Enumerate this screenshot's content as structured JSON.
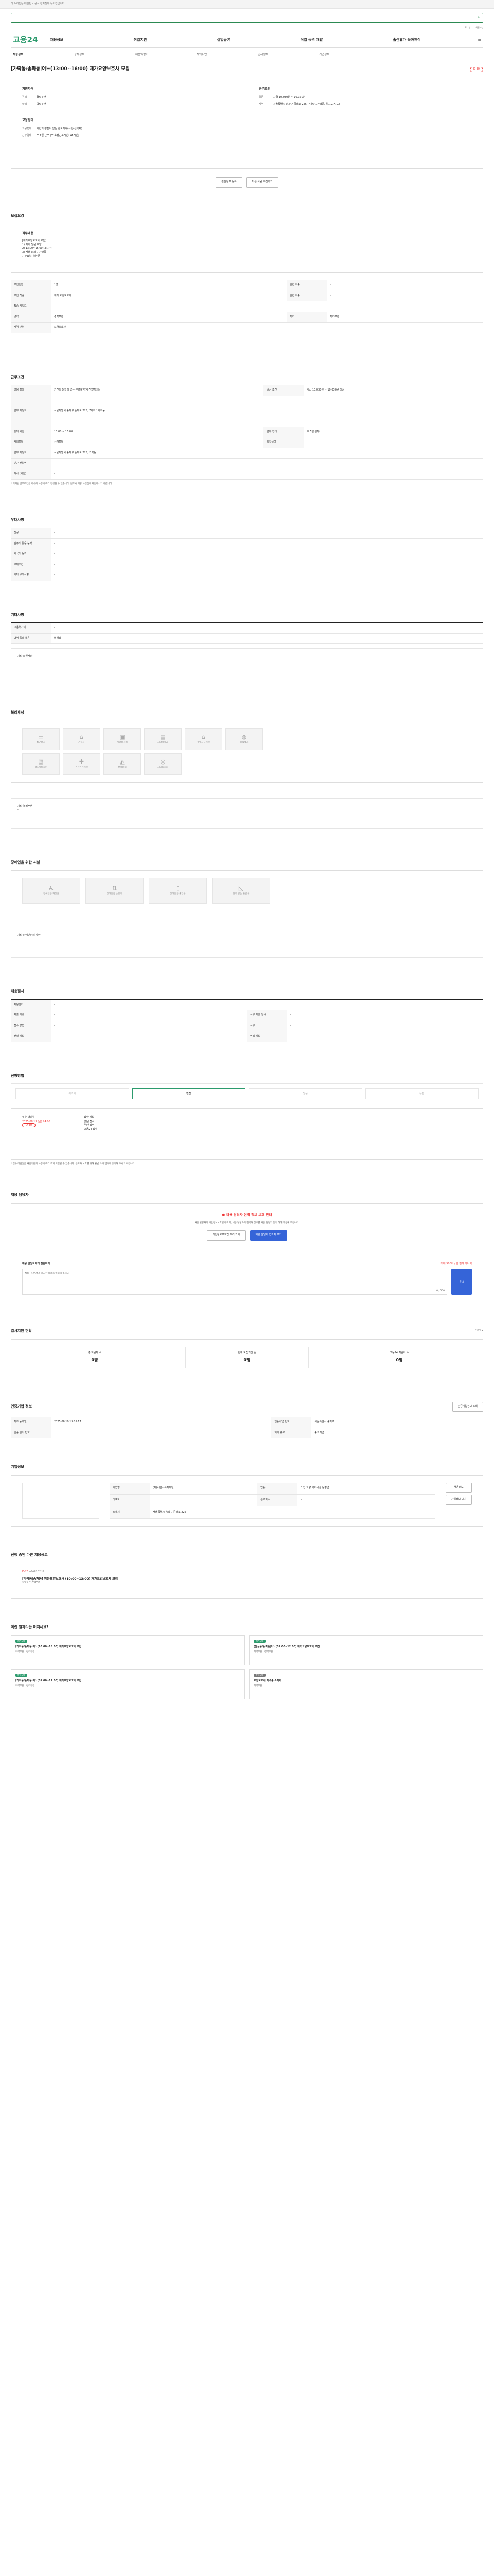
{
  "top": {
    "notice": "이 누리집은 대한민국 공식 전자정부 누리집입니다.",
    "search_placeholder": "",
    "util": [
      "로그인",
      "회원가입"
    ]
  },
  "gnb": {
    "logo": "고용24",
    "menu": [
      "채용정보",
      "취업지원",
      "실업급여",
      "직업 능력 개발",
      "출산휴가 육아휴직"
    ],
    "all": "≡"
  },
  "tabs": [
    "채용정보",
    "공채정보",
    "채용박람회",
    "해외취업",
    "인재정보",
    "기업정보"
  ],
  "title": "[가락동/송파동|어느(13:00~16:00) 재가요양보호사 모집",
  "dday": "D-30",
  "summary": {
    "left": {
      "head": "지원자격",
      "rows": [
        [
          "경력",
          "경력무관"
        ],
        [
          "학력",
          "학력무관"
        ]
      ],
      "head2": "고용형태",
      "rows2": [
        [
          "고용형태",
          "기간의 정함이 없는 근로계약(시간(선택제)"
        ],
        [
          "근무형태",
          "주 5일 근무 (주 소정근로시간: 15시간)"
        ]
      ]
    },
    "right": {
      "head": "근무조건",
      "rows": [
        [
          "임금",
          "시급 10,030원 ~ 10,030원"
        ],
        [
          "지역",
          "서울특별시 송파구 중대로 225, 7가락 1가락동, 위치도(지도)"
        ]
      ]
    },
    "buttons": [
      "관심정보 등록",
      "다른 사람 추천하기"
    ]
  },
  "recruit": {
    "heading": "모집요강",
    "duty_label": "직무내용",
    "duty": "[재가요양보호사 모집]\n1) 재가 방문 요양\n2) 13:00~16:00 (3시간)\n3) 서울 송파구 가락동\n근무요일: 월~금",
    "rows": [
      [
        "모집인원",
        "1명",
        "관련 직종",
        "-"
      ],
      [
        "모집 직종",
        "재가 요양보호사",
        "관련 직종",
        "-"
      ],
      [
        "직종 키워드",
        "-",
        "",
        ""
      ],
      [
        "경력",
        "경력무관",
        "학력",
        "학력무관"
      ],
      [
        "자격 면허",
        "요양보호사",
        "",
        ""
      ]
    ]
  },
  "work": {
    "heading": "근무조건",
    "rows": [
      [
        "고용 형태",
        "기간의 정함이 없는 근로계약(시간(선택제)",
        "임금 조건",
        "시급 10,030원 ~ 10,030원 이상"
      ],
      [
        "근무 예정지",
        "서울특별시 송파구 중대로 225, 7가락 1가락동",
        "",
        ""
      ],
      [
        "출퇴 시간",
        "13:00 ~ 16:00",
        "근무 형태",
        "주 5일 근무"
      ],
      [
        "사회보험",
        "산재보험",
        "퇴직급여",
        "-"
      ],
      [
        "근무 예정지",
        "서울특별시 송파구 중대로 225, 가락동",
        "",
        ""
      ],
      [
        "인근 전철역",
        "-",
        "",
        ""
      ],
      [
        "식사 (시간)",
        "-",
        "",
        ""
      ]
    ],
    "note": "* 기재된 근무조건은 회사의 사정에 따라 변경될 수 있습니다. 반드시 해당 사업장에 확인하시기 바랍니다."
  },
  "pref": {
    "heading": "우대사항",
    "rows": [
      [
        "전공",
        "-"
      ],
      [
        "컴퓨터 활용 능력",
        "-"
      ],
      [
        "외국어 능력",
        "-"
      ],
      [
        "우대조건",
        "-"
      ],
      [
        "기타 우대사항",
        "-"
      ]
    ]
  },
  "etc": {
    "heading": "기타사항",
    "rows": [
      [
        "고용허가제",
        "-"
      ],
      [
        "병역 특례 채용",
        "비해당"
      ]
    ],
    "extra_label": "기타 회원사항"
  },
  "welfare": {
    "heading": "복리후생",
    "items": [
      "통근버스",
      "기숙사",
      "차량유지비",
      "자녀학자금",
      "주택자금지원",
      "중식제공",
      "경조사비지원",
      "건강검진지원",
      "산학협력",
      "사내동호회"
    ],
    "extra_label": "기타 복리후생",
    "extra": "-"
  },
  "support": {
    "heading": "장애인을 위한 시설",
    "items": [
      "장애인용 화장실",
      "장애인용 승강기",
      "장애인용 출입문",
      "단차 없는 출입구"
    ],
    "extra_label": "기타 장애인편의 사항",
    "extra": "-"
  },
  "method_head": {
    "heading": "채용절차",
    "rows": [
      [
        "채용절차",
        "-",
        "",
        ""
      ],
      [
        "제출 서류",
        "-",
        "서류 제출 양식",
        "-"
      ],
      [
        "접수 방법",
        "-",
        "서류",
        "-"
      ],
      [
        "전형 방법",
        "-",
        "면접 방법",
        "-"
      ]
    ]
  },
  "apply": {
    "heading": "전형방법",
    "tabs": [
      "이력서",
      "면접",
      "방문",
      "우편"
    ],
    "deadline_label": "접수 마감일",
    "deadline": "2025.08.19 (금) 24:00",
    "dday": "D-30",
    "method_label": "접수 방법",
    "methods": "방문 접수\n우편 접수\n고용24 접수",
    "notes": "* 접수 마감일은 채용기관의 사정에 따라 조기 마감될 수 있습니다. 근로자 보호를 위해 불법 소개 행위에 유의해 주시기 바랍니다."
  },
  "contact": {
    "heading": "채용 담당자",
    "warn_title": "● 채용 담당자 연락 정보 보호 안내",
    "warn_text": "채용 담당자의 개인정보보호법에 따라, 채용 담당자의 연락처 정보를 채용 담당자 동의 하에 제공해 드립니다.",
    "btns": [
      "개인정보보호법 보러 가기",
      "채용 담당자 연락처 보기"
    ],
    "q_label": "채용 담당자에게 질문하기",
    "q_note": "최대 500자 / 한 번에 하나씩",
    "q_placeholder": "채용 담당자에게 궁금한 내용을 입력해 주세요.",
    "q_count": "0 / 500",
    "q_btn": "문의"
  },
  "stats": {
    "heading": "입사지원 현황",
    "more": "기준일 ▸",
    "items": [
      [
        "총 지원자 수",
        "0명"
      ],
      [
        "현재 모집기간 중",
        "0명"
      ],
      [
        "고용24 지원자 수",
        "0명"
      ]
    ]
  },
  "company": {
    "heading": "인증기업 정보",
    "rows": [
      [
        "최초 등록일",
        "2025.06.19 15:05:17",
        "인증사업 번호",
        "서울특별시 송파구"
      ],
      [
        "인증 관리 번호",
        "",
        "회사 규모",
        "중소기업"
      ]
    ],
    "btn": "인증기업정보 조회"
  },
  "biz": {
    "heading": "기업정보",
    "name_label": "기업명",
    "rows": [
      [
        "기업명",
        "(재)서울시복지재단",
        "업종",
        "노인 요양 복지시설 운영업"
      ],
      [
        "대표자",
        "",
        "근로자수",
        "-"
      ],
      [
        "소재지",
        "서울특별시 송파구 중대로 225",
        "",
        ""
      ]
    ],
    "btns": [
      "채용정보",
      "기업정보 보기"
    ]
  },
  "open_jobs": {
    "heading": "진행 중인 다른 채용공고",
    "items": [
      {
        "dday": "D-26",
        "date": "~2025.07.12",
        "title": "[가락동|송파동] 방문요양보호사 (10:00~13:00) 재가요양보호사 모집",
        "meta": "학력무관 경력무관"
      }
    ]
  },
  "recommend": {
    "heading": "이런 일자리는 어떠세요?",
    "cards": [
      {
        "badge": "재가요양",
        "title": "[가락동/송파동|어느(10:00~18:00) 재가요양보호사 모집",
        "meta": "학력무관 · 경력무관"
      },
      {
        "badge": "재가요양",
        "title": "[잠실동/송파동|어느(09:00~12:00) 재가요양보호사 모집",
        "meta": "학력무관 · 경력무관"
      },
      {
        "badge": "방문요양",
        "title": "[가락동/송파동|어느(09:00~12:00) 재가요양보호사 모집",
        "meta": "학력무관 · 경력무관"
      },
      {
        "badge": "방문요양",
        "title": "요양보호사 자격증 소지자",
        "meta": "학력무관"
      }
    ]
  }
}
